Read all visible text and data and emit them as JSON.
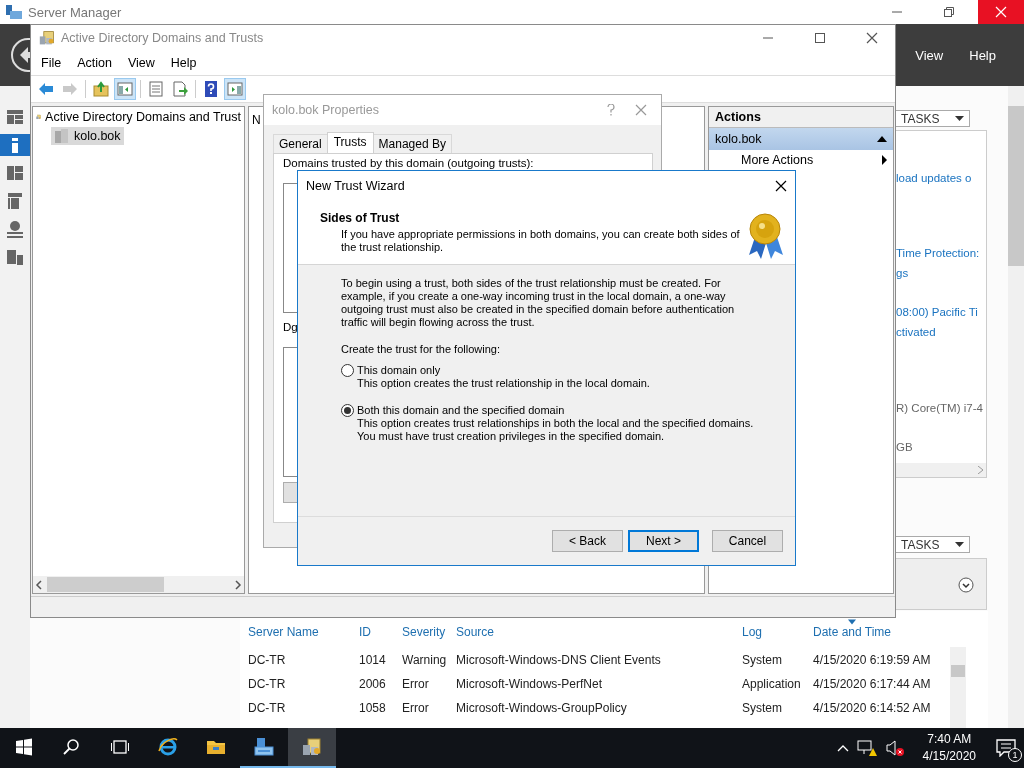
{
  "server_manager": {
    "title": "Server Manager",
    "menu": [
      "View",
      "Help"
    ],
    "sidebar": [
      {
        "kind": "dashboard",
        "selected": false
      },
      {
        "kind": "local",
        "selected": true
      },
      {
        "kind": "all",
        "selected": false
      },
      {
        "kind": "stack",
        "selected": false
      },
      {
        "kind": "network",
        "selected": false
      },
      {
        "kind": "files",
        "selected": false
      }
    ],
    "properties_panel": {
      "tasks": "TASKS",
      "lines": [
        {
          "text": "load updates o",
          "kind": "link"
        },
        {
          "text": "Time Protection:",
          "kind": "link"
        },
        {
          "text": "gs",
          "kind": "link"
        },
        {
          "text": "08:00) Pacific Ti",
          "kind": "link"
        },
        {
          "text": "ctivated",
          "kind": "link"
        },
        {
          "text": "R) Core(TM) i7-4",
          "kind": "text"
        },
        {
          "text": "GB",
          "kind": "text"
        }
      ]
    },
    "events_panel": {
      "tasks": "TASKS",
      "columns": [
        {
          "label": "Server Name",
          "sorted": false
        },
        {
          "label": "ID",
          "sorted": false
        },
        {
          "label": "Severity",
          "sorted": false
        },
        {
          "label": "Source",
          "sorted": false
        },
        {
          "label": "Log",
          "sorted": false
        },
        {
          "label": "Date and Time",
          "sorted": true
        }
      ],
      "rows": [
        [
          "DC-TR",
          "1014",
          "Warning",
          "Microsoft-Windows-DNS Client Events",
          "System",
          "4/15/2020 6:19:59 AM"
        ],
        [
          "DC-TR",
          "2006",
          "Error",
          "Microsoft-Windows-PerfNet",
          "Application",
          "4/15/2020 6:17:44 AM"
        ],
        [
          "DC-TR",
          "1058",
          "Error",
          "Microsoft-Windows-GroupPolicy",
          "System",
          "4/15/2020 6:14:52 AM"
        ]
      ]
    }
  },
  "domains_window": {
    "title": "Active Directory Domains and Trusts",
    "menu": [
      "File",
      "Action",
      "View",
      "Help"
    ],
    "toolbar": [
      {
        "kind": "back",
        "disabled": false,
        "pressed": false
      },
      {
        "kind": "forward",
        "disabled": true,
        "pressed": false
      },
      {
        "kind": "up",
        "disabled": false,
        "pressed": false
      },
      {
        "kind": "tree",
        "disabled": false,
        "pressed": true
      },
      {
        "kind": "properties",
        "disabled": false,
        "pressed": false
      },
      {
        "kind": "export",
        "disabled": false,
        "pressed": false
      },
      {
        "kind": "help",
        "disabled": false,
        "pressed": false
      },
      {
        "kind": "action_pane",
        "disabled": false,
        "pressed": true
      }
    ],
    "tree": {
      "label": "Active Directory Domains and Trust",
      "children": [
        {
          "label": "kolo.bok",
          "selected": true
        }
      ]
    },
    "middle_header": "N",
    "actions": {
      "title": "Actions",
      "group": "kolo.bok",
      "expanded": true,
      "items": [
        {
          "label": "More Actions"
        }
      ]
    }
  },
  "properties_dialog": {
    "title": "kolo.bok Properties",
    "tabs": [
      {
        "label": "General",
        "selected": false
      },
      {
        "label": "Trusts",
        "selected": true
      },
      {
        "label": "Managed By",
        "selected": false
      }
    ],
    "outgoing_label": "Domains trusted by this domain (outgoing trusts):",
    "incoming_label": "Dg"
  },
  "wizard": {
    "title": "New Trust Wizard",
    "heading": "Sides of Trust",
    "subheading": "If you have appropriate permissions in both domains, you can create both sides of the trust relationship.",
    "intro": "To begin using a trust, both sides of the trust relationship must be created. For example, if you create a one-way incoming trust in the local domain, a one-way outgoing trust must also be created in the specified domain before authentication traffic will begin flowing across the trust.",
    "prompt": "Create the trust for the following:",
    "options": [
      {
        "label": "This domain only",
        "description": [
          "This option creates the trust relationship in the local domain."
        ],
        "selected": false
      },
      {
        "label": "Both this domain and the specified domain",
        "description": [
          "This option creates trust relationships in both the local and the specified domains.",
          "You must have trust creation privileges in the specified domain."
        ],
        "selected": true
      }
    ],
    "buttons": [
      {
        "label": "< Back",
        "default": false
      },
      {
        "label": "Next >",
        "default": true
      },
      {
        "label": "Cancel",
        "default": false
      }
    ]
  },
  "taskbar": {
    "apps": [
      {
        "kind": "start",
        "running": false,
        "focused": false
      },
      {
        "kind": "search",
        "running": false,
        "focused": false
      },
      {
        "kind": "task_view",
        "running": false,
        "focused": false
      },
      {
        "kind": "browser",
        "running": false,
        "focused": false
      },
      {
        "kind": "folder",
        "running": false,
        "focused": false
      },
      {
        "kind": "server",
        "running": true,
        "focused": false
      },
      {
        "kind": "domains",
        "running": true,
        "focused": true
      }
    ],
    "time": "7:40 AM",
    "date": "4/15/2020",
    "notifications": "1"
  }
}
